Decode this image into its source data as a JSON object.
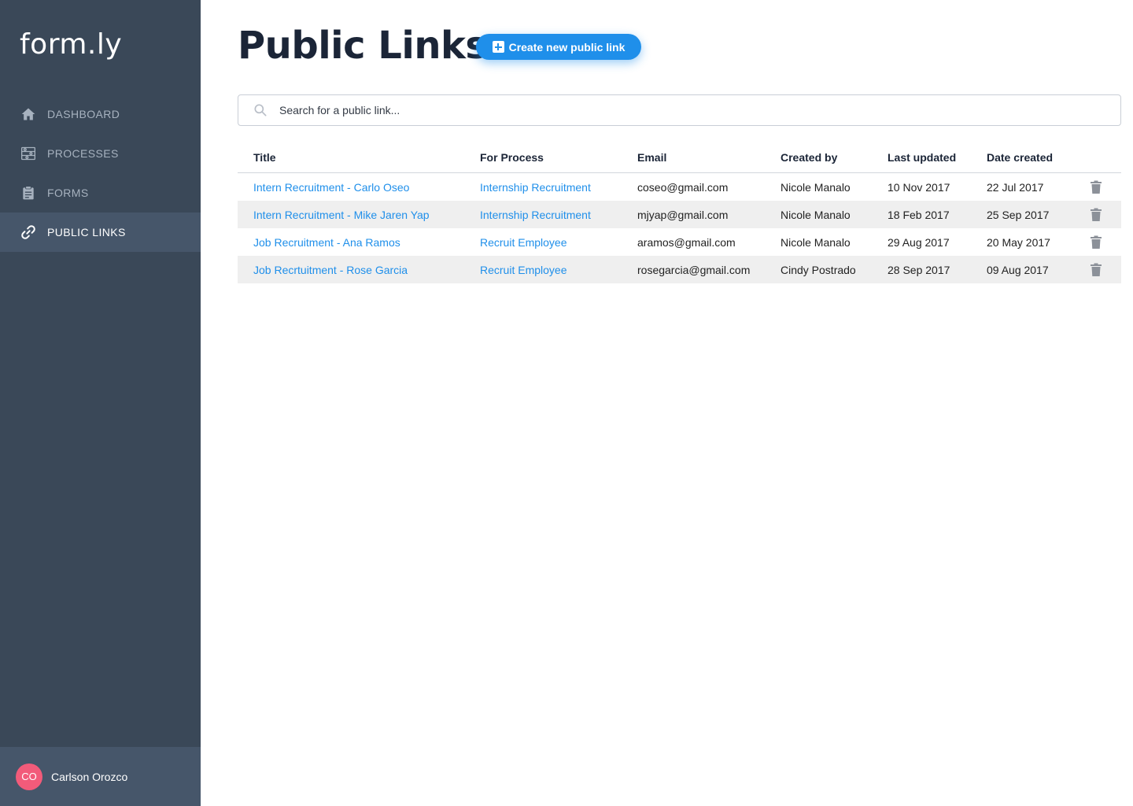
{
  "app": {
    "brand": "form.ly"
  },
  "sidebar": {
    "items": [
      {
        "label": "DASHBOARD",
        "icon": "home-icon",
        "active": false
      },
      {
        "label": "PROCESSES",
        "icon": "processes-icon",
        "active": false
      },
      {
        "label": "FORMS",
        "icon": "clipboard-icon",
        "active": false
      },
      {
        "label": "PUBLIC LINKS",
        "icon": "link-icon",
        "active": true
      }
    ],
    "user": {
      "initials": "CO",
      "name": "Carlson Orozco"
    }
  },
  "header": {
    "title": "Public Links",
    "create_button": "Create new public link"
  },
  "search": {
    "placeholder": "Search for a public link..."
  },
  "table": {
    "columns": [
      "Title",
      "For Process",
      "Email",
      "Created by",
      "Last updated",
      "Date created"
    ],
    "rows": [
      {
        "title": "Intern Recruitment - Carlo Oseo",
        "process": "Internship Recruitment",
        "email": "coseo@gmail.com",
        "created_by": "Nicole Manalo",
        "last_updated": "10 Nov 2017",
        "date_created": "22 Jul 2017"
      },
      {
        "title": "Intern Recruitment - Mike Jaren Yap",
        "process": "Internship Recruitment",
        "email": "mjyap@gmail.com",
        "created_by": "Nicole Manalo",
        "last_updated": "18 Feb 2017",
        "date_created": "25 Sep 2017"
      },
      {
        "title": "Job Recruitment - Ana Ramos",
        "process": "Recruit Employee",
        "email": "aramos@gmail.com",
        "created_by": "Nicole Manalo",
        "last_updated": "29 Aug 2017",
        "date_created": "20 May 2017"
      },
      {
        "title": "Job Recrtuitment - Rose Garcia",
        "process": "Recruit Employee",
        "email": "rosegarcia@gmail.com",
        "created_by": "Cindy Postrado",
        "last_updated": "28 Sep 2017",
        "date_created": "09 Aug 2017"
      }
    ]
  },
  "colors": {
    "sidebar": "#3a4858",
    "sidebar_active": "#46566a",
    "accent": "#1f8fea",
    "avatar": "#f25b7a",
    "title": "#1b2537"
  }
}
